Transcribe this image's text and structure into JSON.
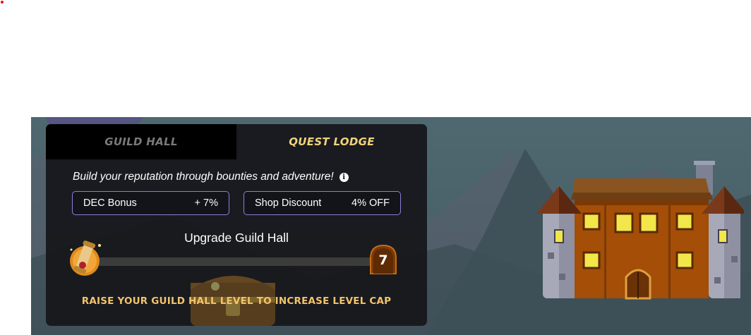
{
  "tabs": [
    {
      "label": "GUILD HALL",
      "active": false
    },
    {
      "label": "QUEST LODGE",
      "active": true
    }
  ],
  "tagline": "Build your reputation through bounties and adventure!",
  "info_icon": "info-icon",
  "stats": {
    "dec_bonus": {
      "label": "DEC Bonus",
      "value": "+ 7%"
    },
    "shop_discount": {
      "label": "Shop Discount",
      "value": "4% OFF"
    }
  },
  "upgrade": {
    "label": "Upgrade Guild Hall",
    "level": "7",
    "progress_fraction": 0.0
  },
  "raise_notice": "RAISE YOUR GUILD HALL LEVEL TO INCREASE LEVEL CAP",
  "colors": {
    "active_tab": "#f2d37a",
    "inactive_tab": "#7a7a7a",
    "stat_border": "#8a7fd8",
    "notice": "#f5c36a",
    "panel": "#16161a"
  }
}
